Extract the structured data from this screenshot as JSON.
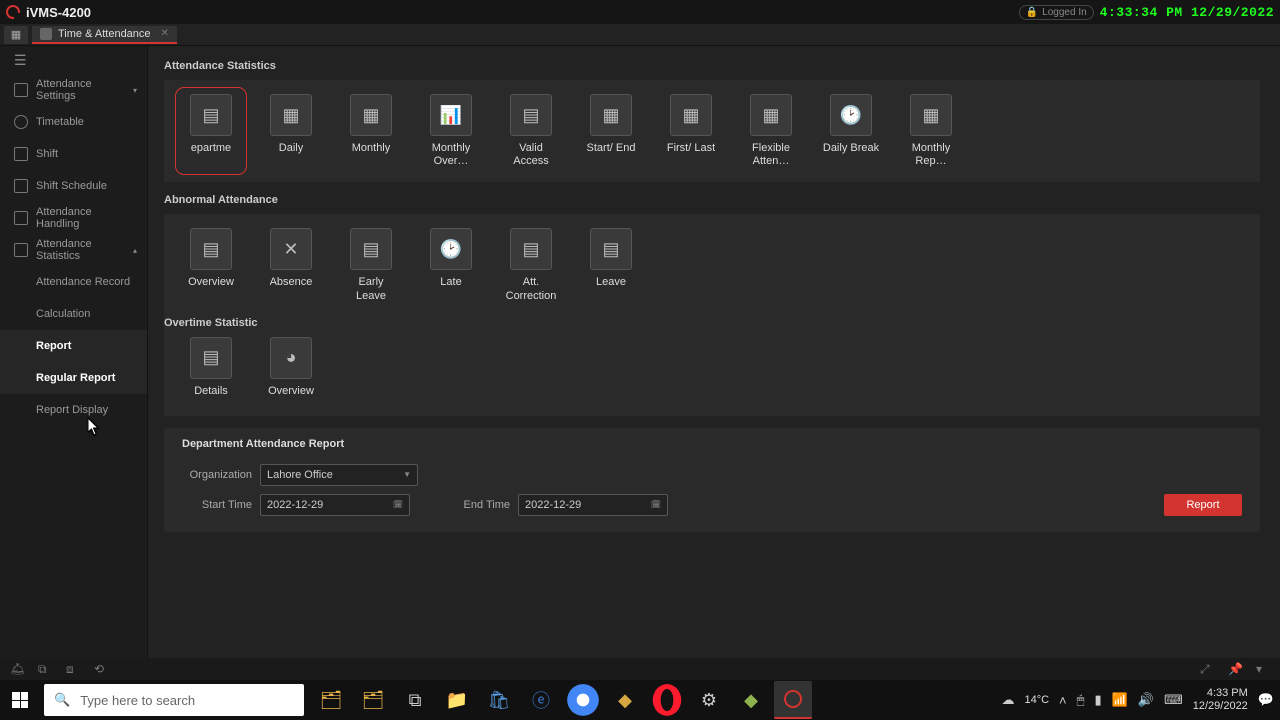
{
  "titlebar": {
    "app_name": "iVMS-4200",
    "logged_in": "Logged In",
    "clock": "4:33:34 PM 12/29/2022"
  },
  "tab": {
    "label": "Time & Attendance"
  },
  "sidebar": {
    "items": [
      {
        "label": "Attendance Settings"
      },
      {
        "label": "Timetable"
      },
      {
        "label": "Shift"
      },
      {
        "label": "Shift Schedule"
      },
      {
        "label": "Attendance Handling"
      },
      {
        "label": "Attendance Statistics"
      },
      {
        "label": "Attendance Record"
      },
      {
        "label": "Calculation"
      },
      {
        "label": "Report"
      },
      {
        "label": "Regular Report"
      },
      {
        "label": "Report Display"
      }
    ]
  },
  "sections": {
    "attendance_statistics": {
      "title": "Attendance Statistics",
      "cards": [
        {
          "label": "epartme"
        },
        {
          "label": "Daily"
        },
        {
          "label": "Monthly"
        },
        {
          "label": "Monthly Over…"
        },
        {
          "label": "Valid Access"
        },
        {
          "label": "Start/ End"
        },
        {
          "label": "First/ Last"
        },
        {
          "label": "Flexible Atten…"
        },
        {
          "label": "Daily Break"
        },
        {
          "label": "Monthly Rep…"
        }
      ]
    },
    "abnormal_attendance": {
      "title": "Abnormal Attendance",
      "cards": [
        {
          "label": "Overview"
        },
        {
          "label": "Absence"
        },
        {
          "label": "Early Leave"
        },
        {
          "label": "Late"
        },
        {
          "label": "Att. Correction"
        },
        {
          "label": "Leave"
        }
      ]
    },
    "overtime_statistic": {
      "title": "Overtime Statistic",
      "cards": [
        {
          "label": "Details"
        },
        {
          "label": "Overview"
        }
      ]
    }
  },
  "form": {
    "title": "Department Attendance Report",
    "org_label": "Organization",
    "org_value": "Lahore Office",
    "start_label": "Start Time",
    "start_value": "2022-12-29",
    "end_label": "End Time",
    "end_value": "2022-12-29",
    "report_btn": "Report"
  },
  "taskbar": {
    "search_placeholder": "Type here to search",
    "weather_temp": "14°C",
    "time": "4:33 PM",
    "date": "12/29/2022"
  }
}
